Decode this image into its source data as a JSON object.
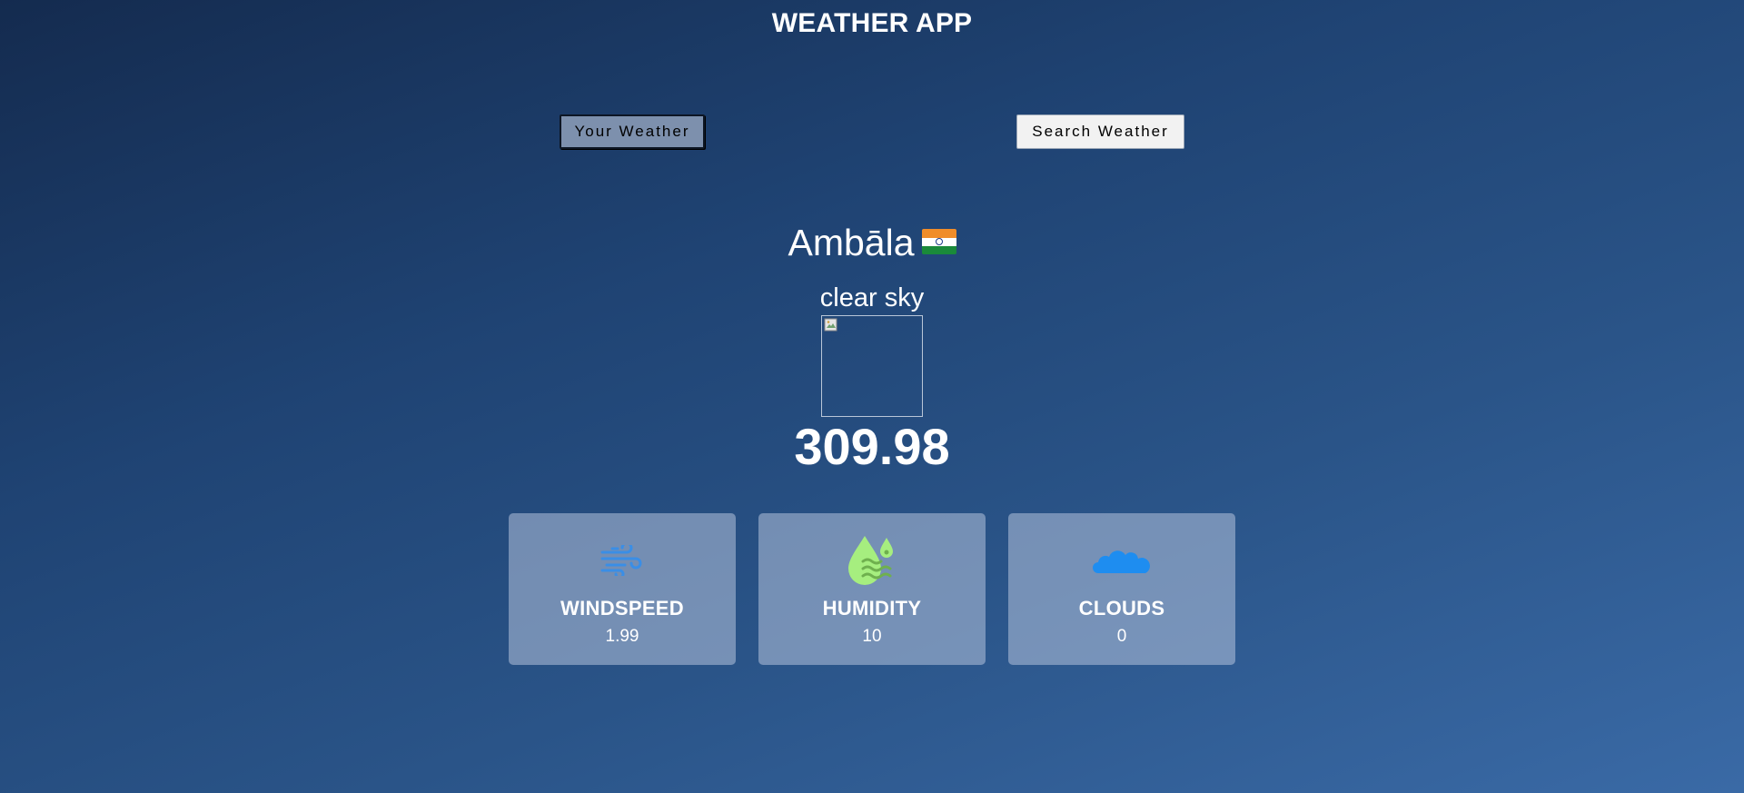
{
  "app": {
    "title": "WEATHER APP"
  },
  "tabs": {
    "your_weather": "Your Weather",
    "search_weather": "Search Weather"
  },
  "location": {
    "city": "Ambāla",
    "flag_icon": "india-flag-icon"
  },
  "weather": {
    "description": "clear sky",
    "temperature": "309.98",
    "icon": "weather-icon-broken-image"
  },
  "stats": [
    {
      "label": "WINDSPEED",
      "value": "1.99",
      "icon": "wind-icon",
      "icon_color": "#3a8ee6"
    },
    {
      "label": "HUMIDITY",
      "value": "10",
      "icon": "humidity-drop-icon",
      "icon_color": "#a6ee7f"
    },
    {
      "label": "CLOUDS",
      "value": "0",
      "icon": "cloud-icon",
      "icon_color": "#1e8df0"
    }
  ],
  "colors": {
    "background_top": "#142b4f",
    "background_bottom": "#3a6aa6",
    "active_tab": "#7d90ad",
    "card_bg": "#8fa2c0"
  }
}
